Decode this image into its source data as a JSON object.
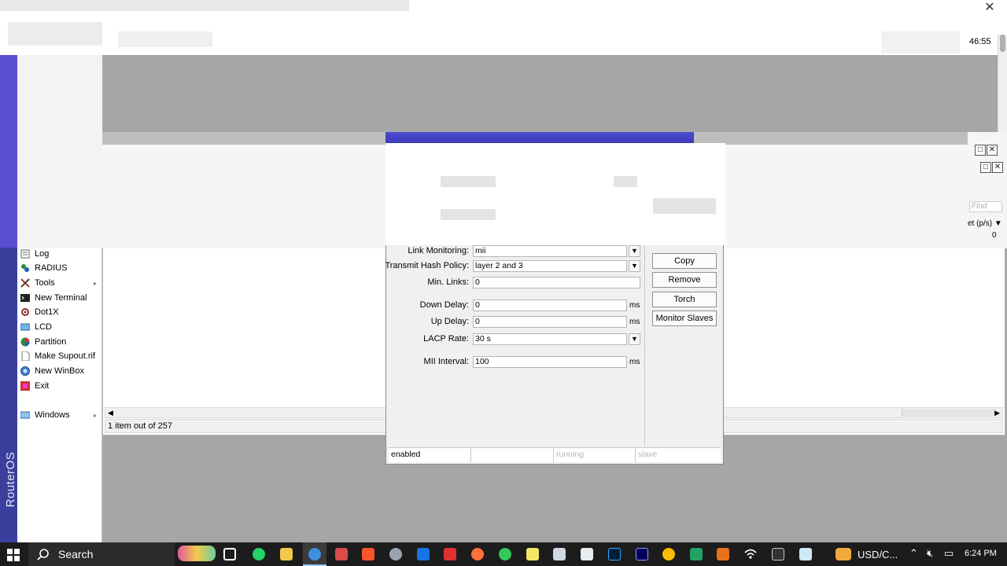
{
  "top": {
    "close_glyph": "✕",
    "clock_fragment": "46:55"
  },
  "sidebar": {
    "vertical_title": "RouterOS WinBox",
    "items": [
      {
        "label": "Log",
        "icon": "log-icon",
        "arrow": ""
      },
      {
        "label": "RADIUS",
        "icon": "radius-icon",
        "arrow": ""
      },
      {
        "label": "Tools",
        "icon": "tools-icon",
        "arrow": "▸"
      },
      {
        "label": "New Terminal",
        "icon": "terminal-icon",
        "arrow": ""
      },
      {
        "label": "Dot1X",
        "icon": "dot1x-icon",
        "arrow": ""
      },
      {
        "label": "LCD",
        "icon": "lcd-icon",
        "arrow": ""
      },
      {
        "label": "Partition",
        "icon": "partition-icon",
        "arrow": ""
      },
      {
        "label": "Make Supout.rif",
        "icon": "supout-icon",
        "arrow": ""
      },
      {
        "label": "New WinBox",
        "icon": "winbox-icon",
        "arrow": ""
      },
      {
        "label": "Exit",
        "icon": "exit-icon",
        "arrow": ""
      }
    ],
    "windows": {
      "label": "Windows",
      "icon": "windows-icon",
      "arrow": "▸"
    }
  },
  "list_window": {
    "find_placeholder": "Find",
    "column_header": "et (p/s)",
    "column_value": "0",
    "status": "1 item out of 257",
    "scroll_left": "◀",
    "scroll_right": "▶"
  },
  "dialog": {
    "fields": {
      "link_monitoring": {
        "label": "Link Monitoring:",
        "value": "mii"
      },
      "transmit_hash_policy": {
        "label": "Transmit Hash Policy:",
        "value": "layer 2 and 3"
      },
      "min_links": {
        "label": "Min. Links:",
        "value": "0"
      },
      "down_delay": {
        "label": "Down Delay:",
        "value": "0",
        "unit": "ms"
      },
      "up_delay": {
        "label": "Up Delay:",
        "value": "0",
        "unit": "ms"
      },
      "lacp_rate": {
        "label": "LACP Rate:",
        "value": "30 s"
      },
      "mii_interval": {
        "label": "MII Interval:",
        "value": "100",
        "unit": "ms"
      }
    },
    "dropdown_glyph": "▼",
    "buttons": {
      "copy": "Copy",
      "remove": "Remove",
      "torch": "Torch",
      "monitor_slaves": "Monitor Slaves"
    },
    "status": {
      "state": "enabled",
      "running": "running",
      "slave": "slave"
    }
  },
  "taskbar": {
    "search_label": "Search",
    "tray_text": "USD/C...",
    "clock": "6:24 PM"
  },
  "colors": {
    "winbox_strip": "#3a3f9e",
    "dialog_title": "#4d4ad2",
    "taskbar": "#1c1c1c"
  }
}
